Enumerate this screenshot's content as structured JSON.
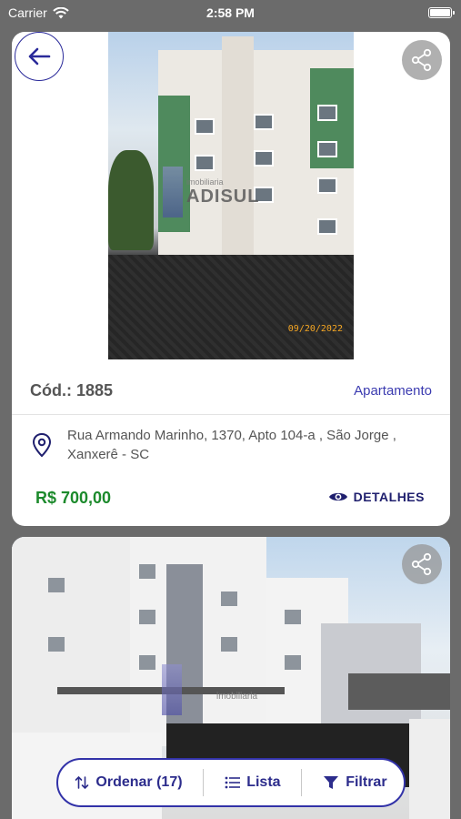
{
  "status_bar": {
    "carrier": "Carrier",
    "time": "2:58 PM"
  },
  "listings": [
    {
      "code_label": "Cód.: 1885",
      "property_type": "Apartamento",
      "address": "Rua Armando Marinho, 1370, Apto 104-a , São Jorge , Xanxerê - SC",
      "price": "R$  700,00",
      "details_label": "DETALHES",
      "photo_date_stamp": "09/20/2022",
      "watermark_text": "ADISUL",
      "watermark_small": "imobiliaria"
    },
    {
      "watermark_small": "imobiliaria"
    }
  ],
  "action_bar": {
    "sort_label": "Ordenar (17)",
    "list_label": "Lista",
    "filter_label": "Filtrar"
  },
  "colors": {
    "accent": "#2c2c8c",
    "price_green": "#1c8a2c",
    "type_blue": "#3b3bb0",
    "background": "#6b6b6b"
  },
  "icons": {
    "back": "arrow-left-icon",
    "share": "share-icon",
    "location": "map-pin-icon",
    "details": "eye-icon",
    "sort": "sort-arrows-icon",
    "list": "list-icon",
    "filter": "filter-icon",
    "wifi": "wifi-icon",
    "battery": "battery-icon"
  }
}
